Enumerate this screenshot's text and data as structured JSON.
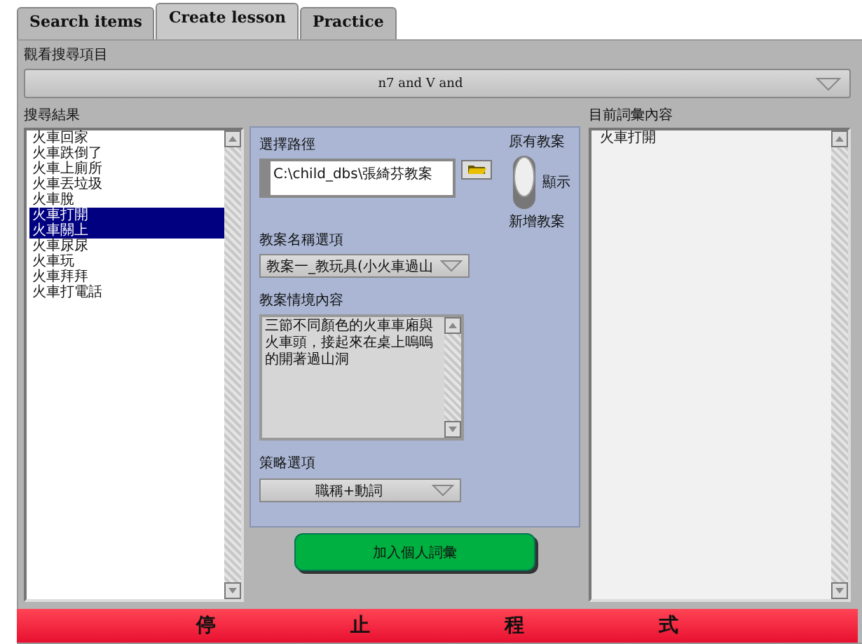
{
  "tabs": [
    {
      "label": "Search items",
      "selected": false
    },
    {
      "label": "Create lesson",
      "selected": true
    },
    {
      "label": "Practice",
      "selected": false
    }
  ],
  "search_view": {
    "label": "觀看搜尋項目",
    "value": "n7 and V and"
  },
  "results": {
    "label": "搜尋結果",
    "items": [
      {
        "text": "火車回家",
        "selected": false
      },
      {
        "text": "火車跌倒了",
        "selected": false
      },
      {
        "text": "火車上廁所",
        "selected": false
      },
      {
        "text": "火車丟垃圾",
        "selected": false
      },
      {
        "text": "火車脫",
        "selected": false
      },
      {
        "text": "火車打開",
        "selected": true
      },
      {
        "text": "火車關上",
        "selected": true
      },
      {
        "text": "火車尿尿",
        "selected": false
      },
      {
        "text": "火車玩",
        "selected": false
      },
      {
        "text": "火車拜拜",
        "selected": false
      },
      {
        "text": "火車打電話",
        "selected": false
      }
    ]
  },
  "lesson": {
    "path_label": "選擇路徑",
    "path": "C:\\child_dbs\\張綺芬教案",
    "switch_top": "原有教案",
    "switch_side": "顯示",
    "switch_on": true,
    "switch_bottom": "新增教案",
    "name_label": "教案名稱選項",
    "name_value": "教案一_教玩具(小火車過山",
    "context_label": "教案情境內容",
    "context": "三節不同顏色的火車車廂與火車頭，接起來在桌上嗚嗚的開著過山洞",
    "strategy_label": "策略選項",
    "strategy_value": "職稱+動詞"
  },
  "add_button": "加入個人詞彙",
  "current": {
    "label": "目前詞彙內容",
    "items": [
      "火車打開"
    ]
  },
  "stop_button": "停止程式"
}
